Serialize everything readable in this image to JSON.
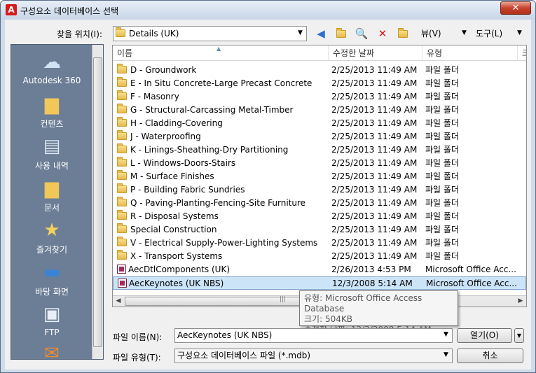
{
  "window": {
    "title": "구성요소 데이터베이스 선택",
    "close_label": "✕"
  },
  "toolbar": {
    "lookin_label": "찾을 위치(I):",
    "lookin_value": "Details (UK)",
    "view_menu": "뷰(V)",
    "tools_menu": "도구(L)"
  },
  "places": [
    {
      "label": "Autodesk 360",
      "icon": "cloud-icon"
    },
    {
      "label": "컨텐츠",
      "icon": "folder-icon"
    },
    {
      "label": "사용 내역",
      "icon": "history-icon"
    },
    {
      "label": "문서",
      "icon": "documents-icon"
    },
    {
      "label": "즐겨찾기",
      "icon": "favorites-icon"
    },
    {
      "label": "바탕 화면",
      "icon": "desktop-icon"
    },
    {
      "label": "FTP",
      "icon": "ftp-icon"
    }
  ],
  "list": {
    "columns": [
      "이름",
      "수정한 날짜",
      "유형",
      "크"
    ],
    "rows": [
      {
        "name": "D - Groundwork",
        "date": "2/25/2013 11:49 AM",
        "type": "파일 폴더",
        "kind": "folder"
      },
      {
        "name": "E - In Situ Concrete-Large Precast Concrete",
        "date": "2/25/2013 11:49 AM",
        "type": "파일 폴더",
        "kind": "folder"
      },
      {
        "name": "F - Masonry",
        "date": "2/25/2013 11:49 AM",
        "type": "파일 폴더",
        "kind": "folder"
      },
      {
        "name": "G - Structural-Carcassing Metal-Timber",
        "date": "2/25/2013 11:49 AM",
        "type": "파일 폴더",
        "kind": "folder"
      },
      {
        "name": "H - Cladding-Covering",
        "date": "2/25/2013 11:49 AM",
        "type": "파일 폴더",
        "kind": "folder"
      },
      {
        "name": "J - Waterproofing",
        "date": "2/25/2013 11:49 AM",
        "type": "파일 폴더",
        "kind": "folder"
      },
      {
        "name": "K - Linings-Sheathing-Dry Partitioning",
        "date": "2/25/2013 11:49 AM",
        "type": "파일 폴더",
        "kind": "folder"
      },
      {
        "name": "L - Windows-Doors-Stairs",
        "date": "2/25/2013 11:49 AM",
        "type": "파일 폴더",
        "kind": "folder"
      },
      {
        "name": "M - Surface Finishes",
        "date": "2/25/2013 11:49 AM",
        "type": "파일 폴더",
        "kind": "folder"
      },
      {
        "name": "P - Building Fabric Sundries",
        "date": "2/25/2013 11:49 AM",
        "type": "파일 폴더",
        "kind": "folder"
      },
      {
        "name": "Q - Paving-Planting-Fencing-Site Furniture",
        "date": "2/25/2013 11:49 AM",
        "type": "파일 폴더",
        "kind": "folder"
      },
      {
        "name": "R - Disposal Systems",
        "date": "2/25/2013 11:49 AM",
        "type": "파일 폴더",
        "kind": "folder"
      },
      {
        "name": "Special Construction",
        "date": "2/25/2013 11:49 AM",
        "type": "파일 폴더",
        "kind": "folder"
      },
      {
        "name": "V - Electrical Supply-Power-Lighting Systems",
        "date": "2/25/2013 11:49 AM",
        "type": "파일 폴더",
        "kind": "folder"
      },
      {
        "name": "X - Transport Systems",
        "date": "2/25/2013 11:49 AM",
        "type": "파일 폴더",
        "kind": "folder"
      },
      {
        "name": "AecDtlComponents (UK)",
        "date": "2/26/2013 4:53 PM",
        "type": "Microsoft Office Acc...",
        "kind": "db"
      },
      {
        "name": "AecKeynotes (UK NBS)",
        "date": "12/3/2008 5:14 AM",
        "type": "Microsoft Office Acc...",
        "kind": "db",
        "selected": true
      }
    ]
  },
  "tooltip": {
    "line1": "유형: Microsoft Office Access Database",
    "line2": "크기: 504KB",
    "line3": "수정한 날짜: 12/3/2008 5:14 AM"
  },
  "bottom": {
    "filename_label": "파일 이름(N):",
    "filename_value": "AecKeynotes (UK NBS)",
    "filetype_label": "파일 유형(T):",
    "filetype_value": "구성요소 데이터베이스 파일 (*.mdb)",
    "open_label": "열기(O)",
    "cancel_label": "취소"
  }
}
